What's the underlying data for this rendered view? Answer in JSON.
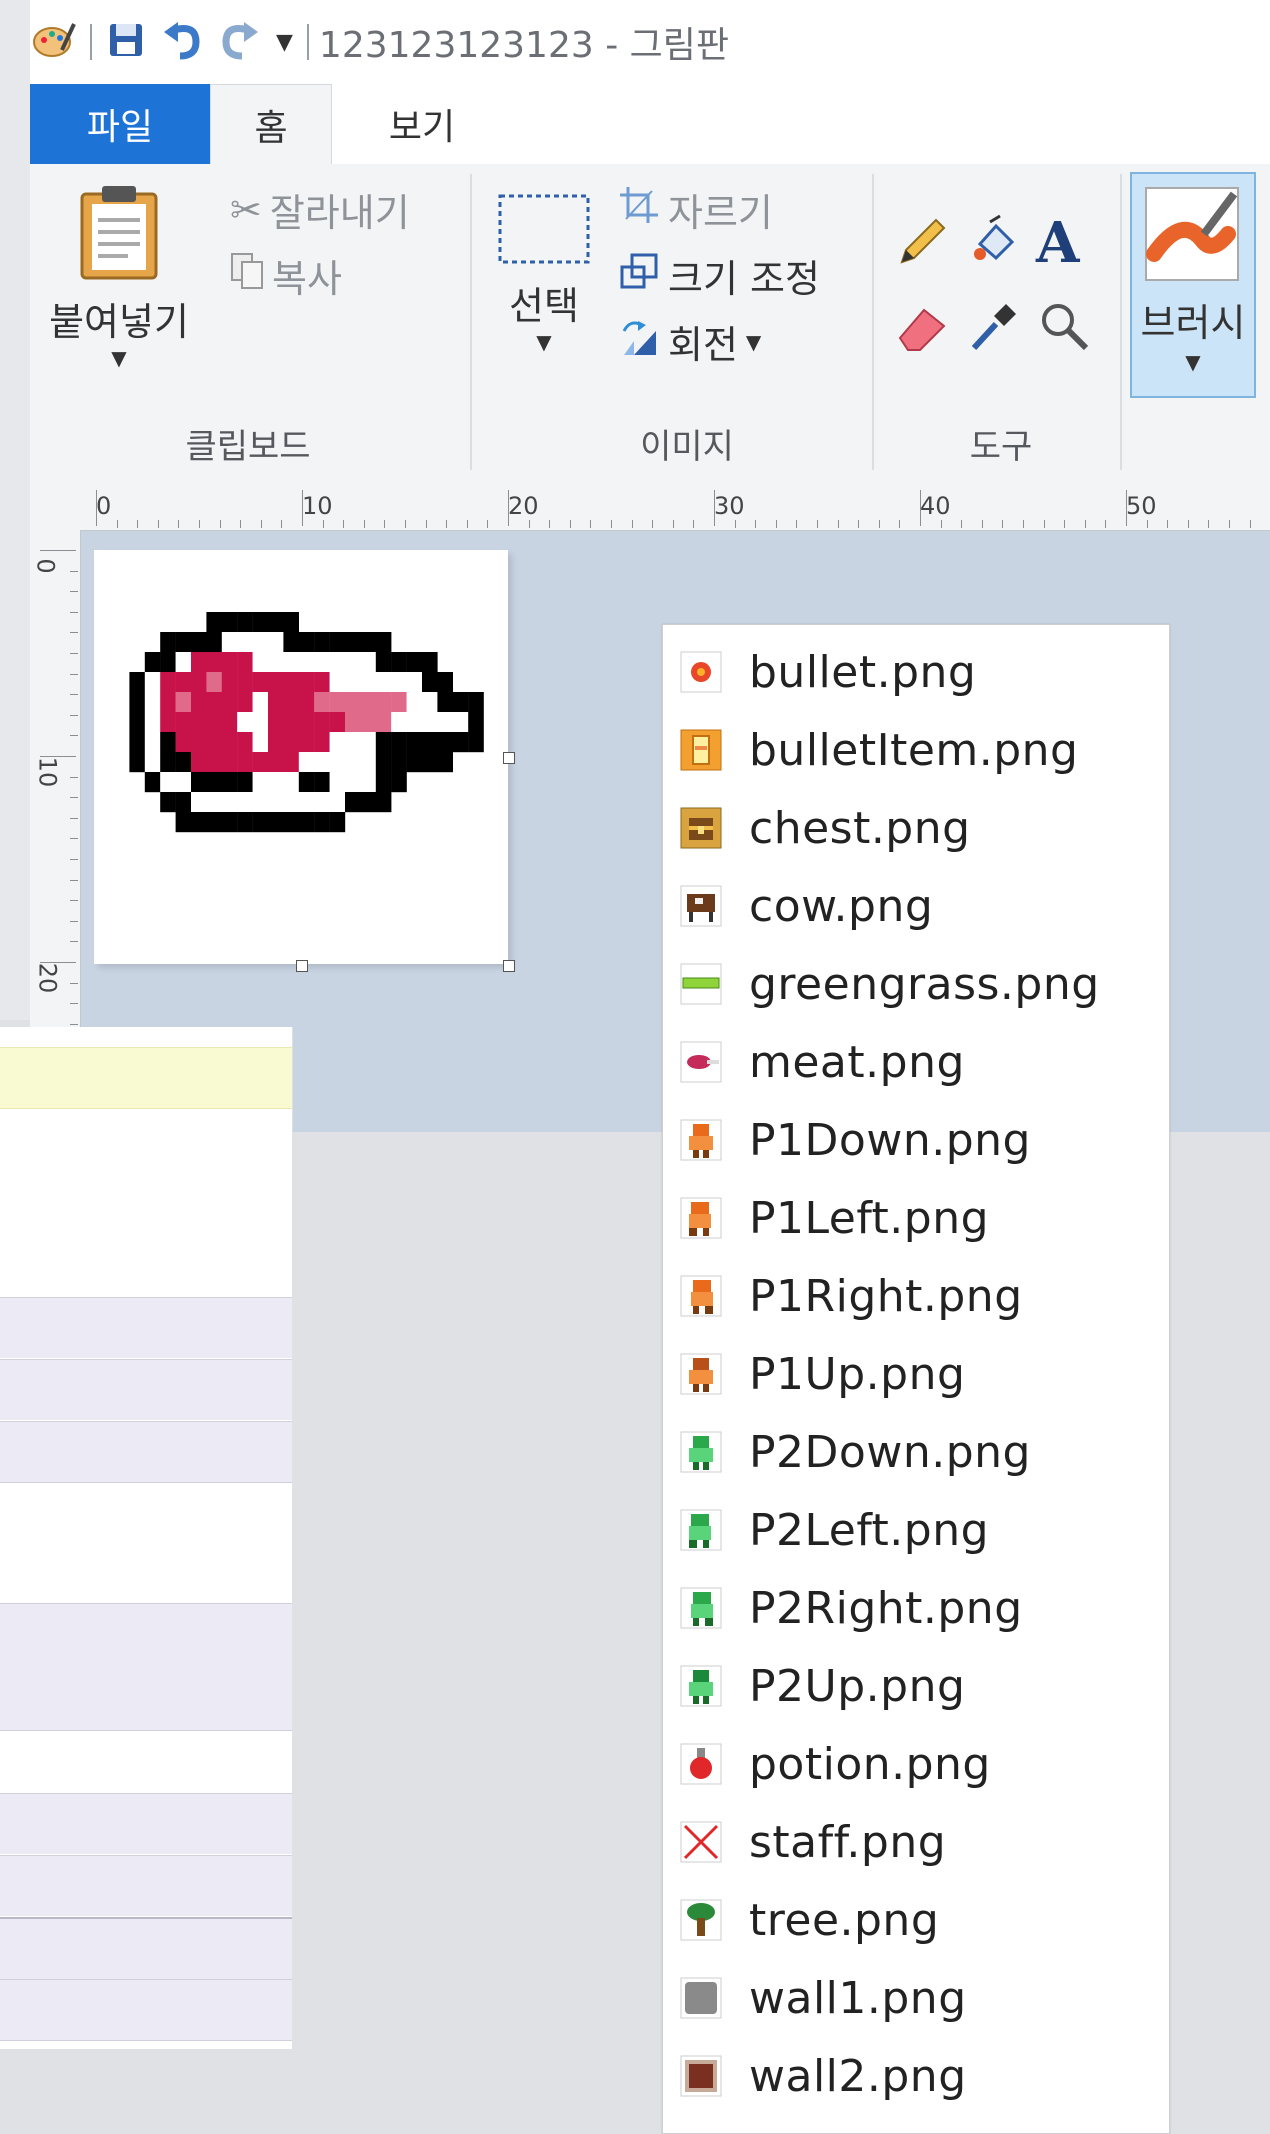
{
  "window": {
    "title": "123123123123 - 그림판",
    "tabs": [
      "파일",
      "홈",
      "보기"
    ]
  },
  "ribbon": {
    "clipboard": {
      "paste_label": "붙여넣기",
      "cut_label": "잘라내기",
      "copy_label": "복사",
      "group_label": "클립보드"
    },
    "image": {
      "select_label": "선택",
      "crop_label": "자르기",
      "resize_label": "크기 조정",
      "rotate_label": "회전",
      "group_label": "이미지"
    },
    "tools": {
      "group_label": "도구"
    },
    "brush": {
      "label": "브러시"
    }
  },
  "ruler": {
    "horizontal": [
      "0",
      "10",
      "20",
      "30",
      "40",
      "50"
    ],
    "vertical": [
      "0",
      "10",
      "20"
    ]
  },
  "files": [
    {
      "name": "bullet.png",
      "icon": "bullet-icon"
    },
    {
      "name": "bulletItem.png",
      "icon": "bullet-item-icon"
    },
    {
      "name": "chest.png",
      "icon": "chest-icon"
    },
    {
      "name": "cow.png",
      "icon": "cow-icon"
    },
    {
      "name": "greengrass.png",
      "icon": "grass-icon"
    },
    {
      "name": "meat.png",
      "icon": "meat-icon"
    },
    {
      "name": "P1Down.png",
      "icon": "player1-down-icon"
    },
    {
      "name": "P1Left.png",
      "icon": "player1-left-icon"
    },
    {
      "name": "P1Right.png",
      "icon": "player1-right-icon"
    },
    {
      "name": "P1Up.png",
      "icon": "player1-up-icon"
    },
    {
      "name": "P2Down.png",
      "icon": "player2-down-icon"
    },
    {
      "name": "P2Left.png",
      "icon": "player2-left-icon"
    },
    {
      "name": "P2Right.png",
      "icon": "player2-right-icon"
    },
    {
      "name": "P2Up.png",
      "icon": "player2-up-icon"
    },
    {
      "name": "potion.png",
      "icon": "potion-icon"
    },
    {
      "name": "staff.png",
      "icon": "broken-image-icon"
    },
    {
      "name": "tree.png",
      "icon": "tree-icon"
    },
    {
      "name": "wall1.png",
      "icon": "wall-grey-icon"
    },
    {
      "name": "wall2.png",
      "icon": "wall-brown-icon"
    }
  ],
  "colors": {
    "file_tab": "#1e73d6",
    "workspace": "#c9d4e3",
    "brush_selected": "#cce4f7"
  }
}
